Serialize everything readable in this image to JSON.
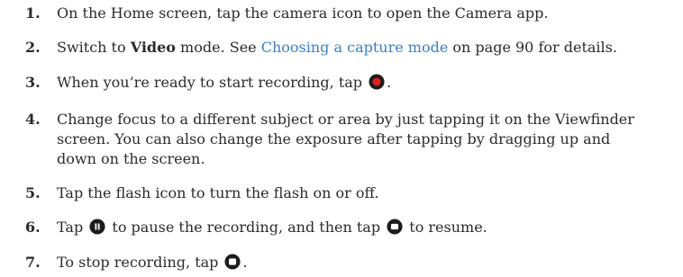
{
  "steps": [
    {
      "number": "1.",
      "text": "On the Home screen, tap the camera icon to open the Camera app."
    },
    {
      "number": "2.",
      "before": "Switch to ",
      "bold": "Video",
      "middle": " mode. See ",
      "link": "Choosing a capture mode",
      "after": " on page 90 for details."
    },
    {
      "number": "3.",
      "before": "When you’re ready to start recording, tap ",
      "after": ".",
      "icon": "record-icon"
    },
    {
      "number": "4.",
      "lines": [
        "Change focus to a different subject or area by just tapping it on the Viewfinder",
        "screen. You can also change the exposure after tapping by dragging up and",
        "down on the screen."
      ]
    },
    {
      "number": "5.",
      "text": "Tap the flash icon to turn the flash on or off."
    },
    {
      "number": "6.",
      "before": "Tap ",
      "middle": " to pause the recording, and then tap ",
      "after": " to resume.",
      "icons": [
        "pause-icon",
        "resume-icon"
      ]
    },
    {
      "number": "7.",
      "before": "To stop recording, tap ",
      "after": ".",
      "icon": "stop-icon"
    }
  ],
  "colors": {
    "text": "#2b2b2b",
    "link": "#3a7fc8",
    "record": "#e0201a",
    "icon_dark": "#2b2b2b"
  }
}
